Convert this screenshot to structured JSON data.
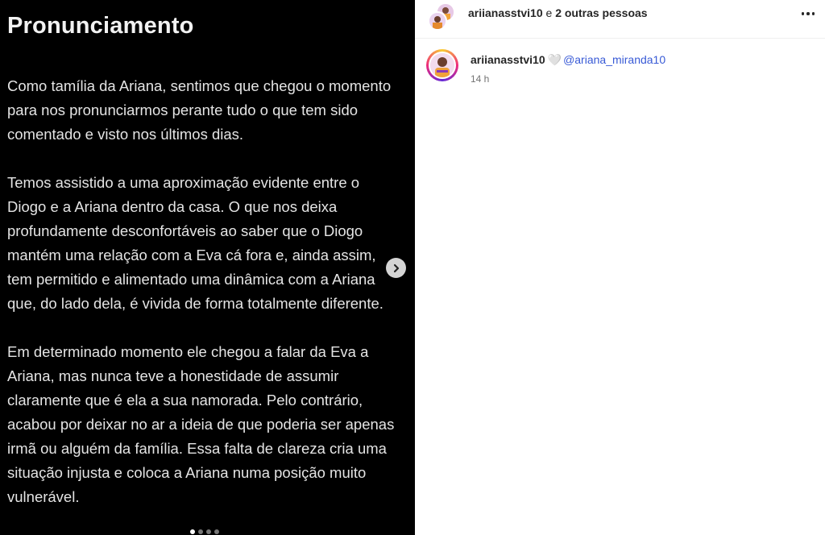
{
  "post": {
    "title": "Pronunciamento",
    "paragraphs": [
      "Como tamília da Ariana, sentimos que chegou o momento\npara nos pronunciarmos perante tudo o que tem sido\ncomentado e visto nos últimos dias.",
      "Temos assistido a uma aproximação evidente entre o\nDiogo e a Ariana dentro da casa. O que nos deixa\nprofundamente desconfortáveis ao saber que o Diogo\nmantém uma relação com a Eva cá fora e, ainda assim,\ntem permitido e alimentado uma dinâmica com a Ariana\nque, do lado dela, é vivida de forma totalmente diferente.",
      "Em determinado momento ele chegou a falar da Eva a\nAriana, mas nunca teve a honestidade de assumir\nclaramente que é ela a sua namorada. Pelo contrário,\nacabou por deixar no ar a ideia de que poderia ser apenas\nirmã ou alguém da família. Essa falta de clareza cria uma\nsituação injusta e coloca a Ariana numa posição muito\nvulnerável."
    ],
    "carousel": {
      "total": 4,
      "current": 1
    }
  },
  "header": {
    "username": "ariianasstvi10",
    "connector": "e",
    "others": "2 outras pessoas",
    "more_icon": "more-horizontal-icon"
  },
  "caption": {
    "username": "ariianasstvi10",
    "heart": "🤍",
    "mention": "@ariana_miranda10",
    "time": "14 h"
  },
  "colors": {
    "mention": "#385ad6",
    "story_ring": [
      "#f9ce34",
      "#ee2a7b",
      "#6228d7"
    ]
  }
}
